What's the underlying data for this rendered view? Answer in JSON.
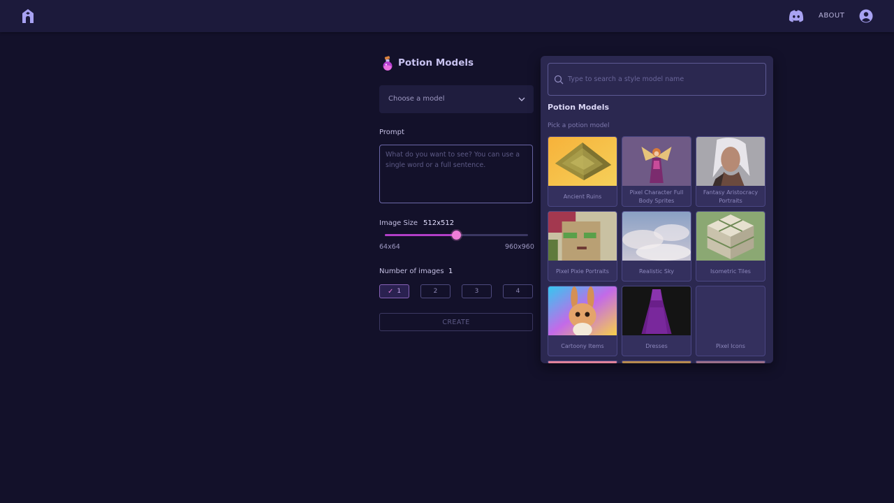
{
  "header": {
    "logo_icon": "potion-logo-icon",
    "discord_icon": "discord-icon",
    "about_label": "ABOUT",
    "account_icon": "account-circle-icon"
  },
  "form": {
    "title": "Potion Models",
    "title_icon": "potion-bottle-icon",
    "model_select": {
      "value": "Choose a model",
      "icon": "chevron-down-icon"
    },
    "prompt": {
      "label": "Prompt",
      "placeholder": "What do you want to see? You can use a single word or a full sentence.",
      "value": ""
    },
    "image_size": {
      "label": "Image Size",
      "value": "512x512",
      "min_label": "64x64",
      "max_label": "960x960",
      "slider_fraction": 0.5
    },
    "num_images": {
      "label": "Number of images",
      "value": "1",
      "options": [
        "1",
        "2",
        "3",
        "4"
      ],
      "selected": "1"
    },
    "create_label": "CREATE"
  },
  "dropdown": {
    "search_placeholder": "Type to search a style model name",
    "section_title": "Potion Models",
    "section_subtitle": "Pick a potion model",
    "models": [
      {
        "name": "Ancient Ruins"
      },
      {
        "name": "Pixel Character Full Body Sprites"
      },
      {
        "name": "Fantasy Aristocracy Portraits"
      },
      {
        "name": "Pixel Pixie Portraits"
      },
      {
        "name": "Realistic Sky"
      },
      {
        "name": "Isometric Tiles"
      },
      {
        "name": "Cartoony Items"
      },
      {
        "name": "Dresses"
      },
      {
        "name": "Pixel Icons"
      }
    ]
  },
  "colors": {
    "background": "#13112a",
    "topbar": "#1c1a3b",
    "panel": "#2b2850",
    "accent": "#b23fc8",
    "slider_thumb": "#f07ed8"
  }
}
